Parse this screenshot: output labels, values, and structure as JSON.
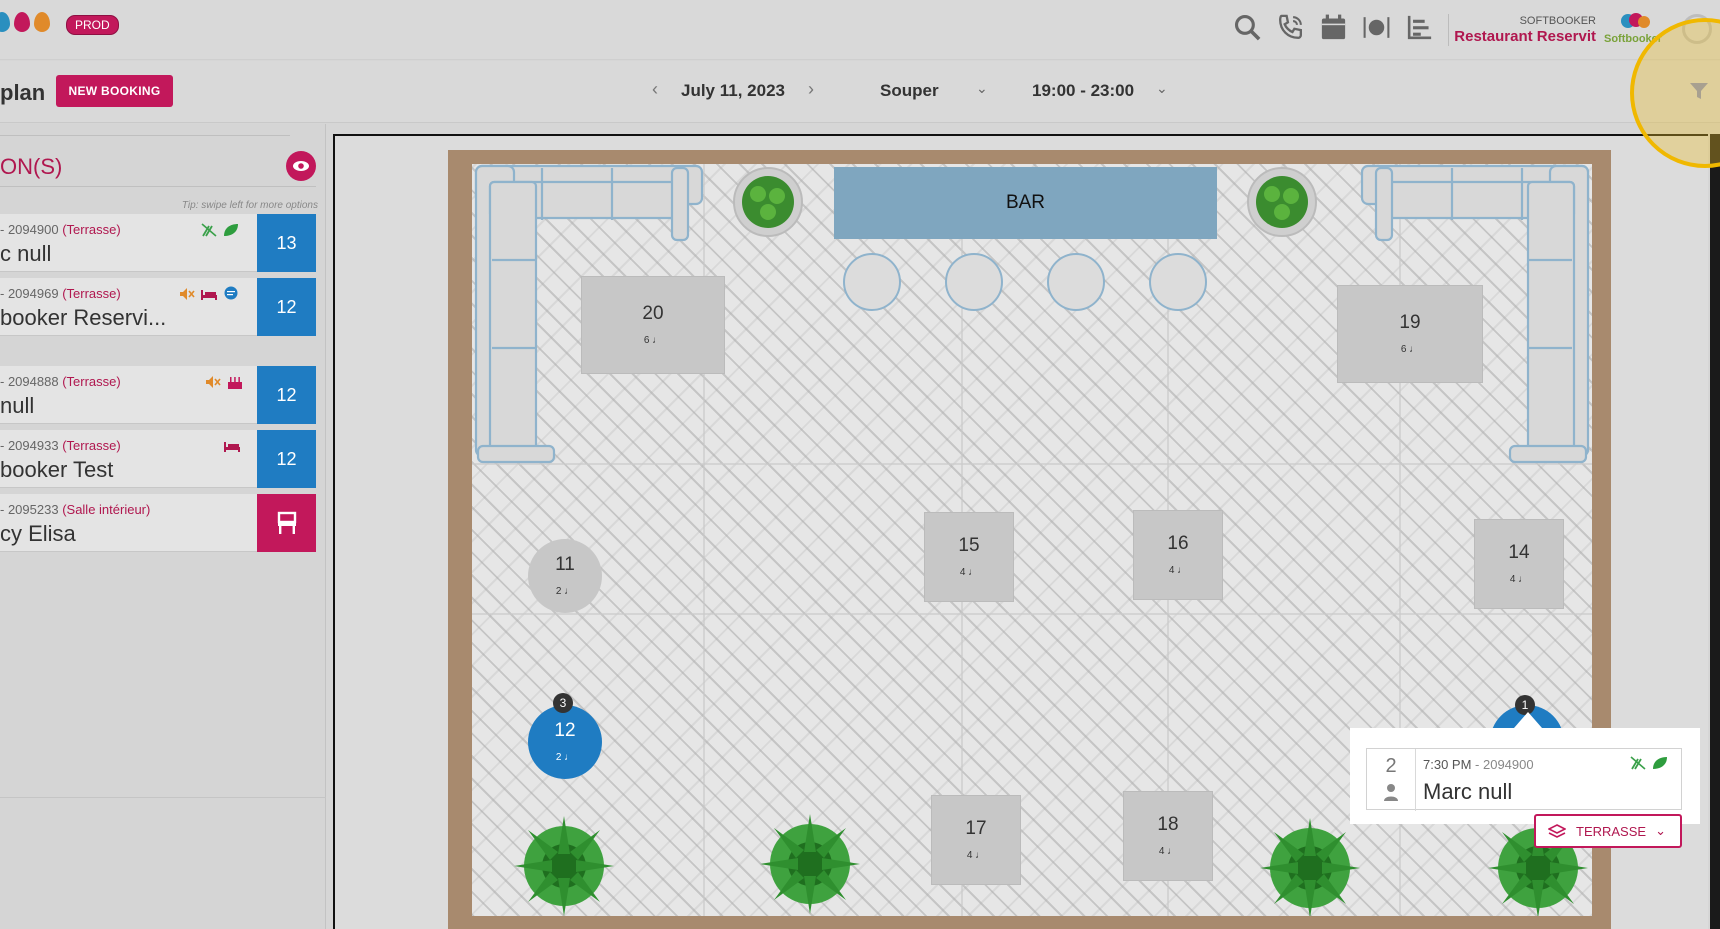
{
  "header": {
    "env_badge": "PROD",
    "company_small": "SOFTBOOKER",
    "restaurant_name": "Restaurant Reservit",
    "logo_text": "Softbooker",
    "icons": [
      "search-icon",
      "phone-icon",
      "calendar-icon",
      "dining-icon",
      "stats-icon"
    ]
  },
  "toolbar": {
    "page_title": "plan",
    "new_booking": "NEW BOOKING",
    "date": "July 11, 2023",
    "service": "Souper",
    "time_range": "19:00 - 23:00"
  },
  "left_panel": {
    "section_title": "ON(S)",
    "tip": "Tip: swipe left for more options",
    "reservations": [
      {
        "meta_prefix": "- 2094900",
        "zone": "(Terrasse)",
        "name": "c null",
        "table": "13",
        "table_color": "blue",
        "icons": [
          "no-gluten-icon",
          "leaf-icon"
        ]
      },
      {
        "meta_prefix": "- 2094969",
        "zone": "(Terrasse)",
        "name": "booker Reservi...",
        "table": "12",
        "table_color": "blue",
        "icons": [
          "mute-icon",
          "bed-icon",
          "chat-icon"
        ]
      },
      {
        "meta_prefix": "- 2094888",
        "zone": "(Terrasse)",
        "name": " null",
        "table": "12",
        "table_color": "blue",
        "icons": [
          "mute-icon",
          "cake-icon"
        ]
      },
      {
        "meta_prefix": "- 2094933",
        "zone": "(Terrasse)",
        "name": "booker Test",
        "table": "12",
        "table_color": "blue",
        "icons": [
          "bed-icon"
        ]
      },
      {
        "meta_prefix": "- 2095233",
        "zone": "(Salle intérieur)",
        "name": "cy Elisa",
        "table": "",
        "table_color": "pink",
        "icons": []
      }
    ]
  },
  "floor_plan": {
    "bar_label": "BAR",
    "tables": [
      {
        "id": "20",
        "seats": "6"
      },
      {
        "id": "19",
        "seats": "6"
      },
      {
        "id": "11",
        "seats": "2"
      },
      {
        "id": "15",
        "seats": "4"
      },
      {
        "id": "16",
        "seats": "4"
      },
      {
        "id": "14",
        "seats": "4"
      },
      {
        "id": "12",
        "seats": "2",
        "badge": "3"
      },
      {
        "id": "17",
        "seats": "4"
      },
      {
        "id": "18",
        "seats": "4"
      }
    ],
    "table13_badge": "1"
  },
  "popup": {
    "guests": "2",
    "time": "7:30 PM",
    "separator": " - ",
    "ref": "2094900",
    "name": "Marc null"
  },
  "zone_select": {
    "label": "TERRASSE"
  },
  "colors": {
    "brand": "#c2185b",
    "table_blue": "#1f7cc2",
    "highlight": "#f0b800"
  }
}
